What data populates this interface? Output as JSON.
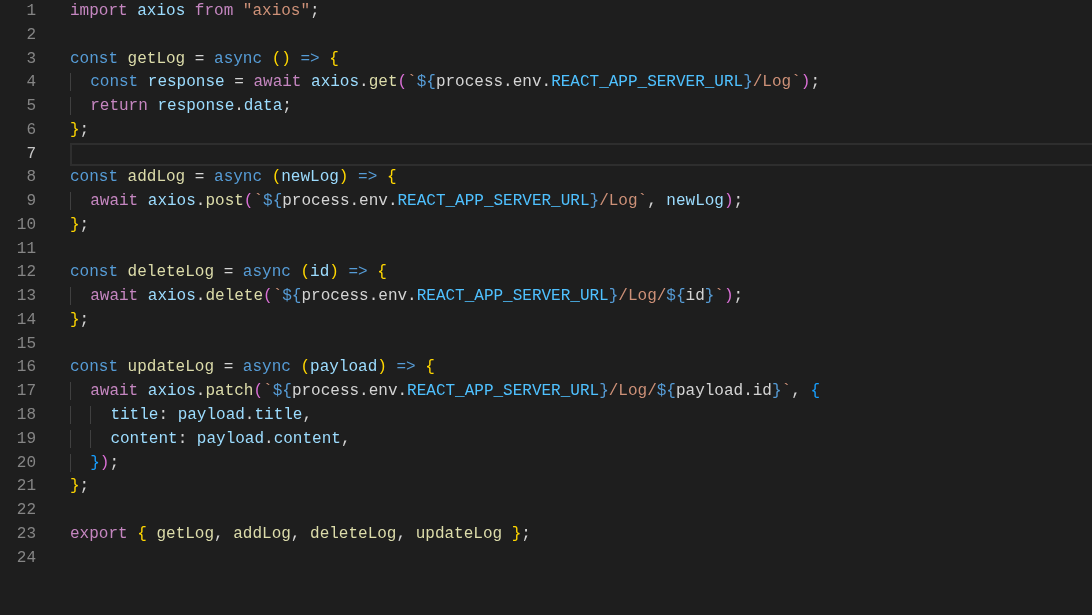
{
  "editor": {
    "lines": [
      {
        "number": "1",
        "current": false,
        "tokens": [
          {
            "text": "import ",
            "kind": "kw"
          },
          {
            "text": "axios ",
            "kind": "var"
          },
          {
            "text": "from ",
            "kind": "kw"
          },
          {
            "text": "\"axios\"",
            "kind": "str"
          },
          {
            "text": ";",
            "kind": "pl"
          }
        ]
      },
      {
        "number": "2",
        "current": false
      },
      {
        "number": "3",
        "current": false,
        "tokens": [
          {
            "text": "const ",
            "kind": "st"
          },
          {
            "text": "getLog",
            "kind": "fn"
          },
          {
            "text": " = ",
            "kind": "pl"
          },
          {
            "text": "async ",
            "kind": "st"
          },
          {
            "text": "() ",
            "kind": "b1"
          },
          {
            "text": "=> ",
            "kind": "st"
          },
          {
            "text": "{",
            "kind": "b1"
          }
        ]
      },
      {
        "number": "4",
        "current": false,
        "tokens": [
          {
            "text": "  const ",
            "kind": "st"
          },
          {
            "text": "response",
            "kind": "var"
          },
          {
            "text": " = ",
            "kind": "pl"
          },
          {
            "text": "await ",
            "kind": "kw"
          },
          {
            "text": "axios",
            "kind": "var"
          },
          {
            "text": ".",
            "kind": "pl"
          },
          {
            "text": "get",
            "kind": "fn"
          },
          {
            "text": "(",
            "kind": "b2"
          },
          {
            "text": "`",
            "kind": "str"
          },
          {
            "text": "${",
            "kind": "tpl"
          },
          {
            "text": "process.env.",
            "kind": "pl"
          },
          {
            "text": "REACT_APP_SERVER_URL",
            "kind": "const"
          },
          {
            "text": "}",
            "kind": "tpl"
          },
          {
            "text": "/Log`",
            "kind": "str"
          },
          {
            "text": ")",
            "kind": "b2"
          },
          {
            "text": ";",
            "kind": "pl"
          }
        ]
      },
      {
        "number": "5",
        "current": false,
        "tokens": [
          {
            "text": "  return ",
            "kind": "kw"
          },
          {
            "text": "response",
            "kind": "var"
          },
          {
            "text": ".",
            "kind": "pl"
          },
          {
            "text": "data",
            "kind": "var"
          },
          {
            "text": ";",
            "kind": "pl"
          }
        ]
      },
      {
        "number": "6",
        "current": false,
        "tokens": [
          {
            "text": "}",
            "kind": "b1"
          },
          {
            "text": ";",
            "kind": "pl"
          }
        ]
      },
      {
        "number": "7",
        "current": true
      },
      {
        "number": "8",
        "current": false,
        "tokens": [
          {
            "text": "const ",
            "kind": "st"
          },
          {
            "text": "addLog",
            "kind": "fn"
          },
          {
            "text": " = ",
            "kind": "pl"
          },
          {
            "text": "async ",
            "kind": "st"
          },
          {
            "text": "(",
            "kind": "b1"
          },
          {
            "text": "newLog",
            "kind": "var"
          },
          {
            "text": ") ",
            "kind": "b1"
          },
          {
            "text": "=> ",
            "kind": "st"
          },
          {
            "text": "{",
            "kind": "b1"
          }
        ]
      },
      {
        "number": "9",
        "current": false,
        "tokens": [
          {
            "text": "  await ",
            "kind": "kw"
          },
          {
            "text": "axios",
            "kind": "var"
          },
          {
            "text": ".",
            "kind": "pl"
          },
          {
            "text": "post",
            "kind": "fn"
          },
          {
            "text": "(",
            "kind": "b2"
          },
          {
            "text": "`",
            "kind": "str"
          },
          {
            "text": "${",
            "kind": "tpl"
          },
          {
            "text": "process.env.",
            "kind": "pl"
          },
          {
            "text": "REACT_APP_SERVER_URL",
            "kind": "const"
          },
          {
            "text": "}",
            "kind": "tpl"
          },
          {
            "text": "/Log`",
            "kind": "str"
          },
          {
            "text": ", ",
            "kind": "pl"
          },
          {
            "text": "newLog",
            "kind": "var"
          },
          {
            "text": ")",
            "kind": "b2"
          },
          {
            "text": ";",
            "kind": "pl"
          }
        ]
      },
      {
        "number": "10",
        "current": false,
        "tokens": [
          {
            "text": "}",
            "kind": "b1"
          },
          {
            "text": ";",
            "kind": "pl"
          }
        ]
      },
      {
        "number": "11",
        "current": false
      },
      {
        "number": "12",
        "current": false,
        "tokens": [
          {
            "text": "const ",
            "kind": "st"
          },
          {
            "text": "deleteLog",
            "kind": "fn"
          },
          {
            "text": " = ",
            "kind": "pl"
          },
          {
            "text": "async ",
            "kind": "st"
          },
          {
            "text": "(",
            "kind": "b1"
          },
          {
            "text": "id",
            "kind": "var"
          },
          {
            "text": ") ",
            "kind": "b1"
          },
          {
            "text": "=> ",
            "kind": "st"
          },
          {
            "text": "{",
            "kind": "b1"
          }
        ]
      },
      {
        "number": "13",
        "current": false,
        "tokens": [
          {
            "text": "  await ",
            "kind": "kw"
          },
          {
            "text": "axios",
            "kind": "var"
          },
          {
            "text": ".",
            "kind": "pl"
          },
          {
            "text": "delete",
            "kind": "fn"
          },
          {
            "text": "(",
            "kind": "b2"
          },
          {
            "text": "`",
            "kind": "str"
          },
          {
            "text": "${",
            "kind": "tpl"
          },
          {
            "text": "process.env.",
            "kind": "pl"
          },
          {
            "text": "REACT_APP_SERVER_URL",
            "kind": "const"
          },
          {
            "text": "}",
            "kind": "tpl"
          },
          {
            "text": "/Log/",
            "kind": "str"
          },
          {
            "text": "${",
            "kind": "tpl"
          },
          {
            "text": "id",
            "kind": "pl"
          },
          {
            "text": "}",
            "kind": "tpl"
          },
          {
            "text": "`",
            "kind": "str"
          },
          {
            "text": ")",
            "kind": "b2"
          },
          {
            "text": ";",
            "kind": "pl"
          }
        ]
      },
      {
        "number": "14",
        "current": false,
        "tokens": [
          {
            "text": "}",
            "kind": "b1"
          },
          {
            "text": ";",
            "kind": "pl"
          }
        ]
      },
      {
        "number": "15",
        "current": false
      },
      {
        "number": "16",
        "current": false,
        "tokens": [
          {
            "text": "const ",
            "kind": "st"
          },
          {
            "text": "updateLog",
            "kind": "fn"
          },
          {
            "text": " = ",
            "kind": "pl"
          },
          {
            "text": "async ",
            "kind": "st"
          },
          {
            "text": "(",
            "kind": "b1"
          },
          {
            "text": "payload",
            "kind": "var"
          },
          {
            "text": ") ",
            "kind": "b1"
          },
          {
            "text": "=> ",
            "kind": "st"
          },
          {
            "text": "{",
            "kind": "b1"
          }
        ]
      },
      {
        "number": "17",
        "current": false,
        "tokens": [
          {
            "text": "  await ",
            "kind": "kw"
          },
          {
            "text": "axios",
            "kind": "var"
          },
          {
            "text": ".",
            "kind": "pl"
          },
          {
            "text": "patch",
            "kind": "fn"
          },
          {
            "text": "(",
            "kind": "b2"
          },
          {
            "text": "`",
            "kind": "str"
          },
          {
            "text": "${",
            "kind": "tpl"
          },
          {
            "text": "process.env.",
            "kind": "pl"
          },
          {
            "text": "REACT_APP_SERVER_URL",
            "kind": "const"
          },
          {
            "text": "}",
            "kind": "tpl"
          },
          {
            "text": "/Log/",
            "kind": "str"
          },
          {
            "text": "${",
            "kind": "tpl"
          },
          {
            "text": "payload.id",
            "kind": "pl"
          },
          {
            "text": "}",
            "kind": "tpl"
          },
          {
            "text": "`",
            "kind": "str"
          },
          {
            "text": ", ",
            "kind": "pl"
          },
          {
            "text": "{",
            "kind": "b3"
          }
        ]
      },
      {
        "number": "18",
        "current": false,
        "tokens": [
          {
            "text": "    title",
            "kind": "var"
          },
          {
            "text": ": ",
            "kind": "pl"
          },
          {
            "text": "payload",
            "kind": "var"
          },
          {
            "text": ".",
            "kind": "pl"
          },
          {
            "text": "title",
            "kind": "var"
          },
          {
            "text": ",",
            "kind": "pl"
          }
        ]
      },
      {
        "number": "19",
        "current": false,
        "tokens": [
          {
            "text": "    content",
            "kind": "var"
          },
          {
            "text": ": ",
            "kind": "pl"
          },
          {
            "text": "payload",
            "kind": "var"
          },
          {
            "text": ".",
            "kind": "pl"
          },
          {
            "text": "content",
            "kind": "var"
          },
          {
            "text": ",",
            "kind": "pl"
          }
        ]
      },
      {
        "number": "20",
        "current": false,
        "tokens": [
          {
            "text": "  }",
            "kind": "b3"
          },
          {
            "text": ")",
            "kind": "b2"
          },
          {
            "text": ";",
            "kind": "pl"
          }
        ]
      },
      {
        "number": "21",
        "current": false,
        "tokens": [
          {
            "text": "}",
            "kind": "b1"
          },
          {
            "text": ";",
            "kind": "pl"
          }
        ]
      },
      {
        "number": "22",
        "current": false
      },
      {
        "number": "23",
        "current": false,
        "tokens": [
          {
            "text": "export ",
            "kind": "kw"
          },
          {
            "text": "{ ",
            "kind": "b1"
          },
          {
            "text": "getLog",
            "kind": "fn"
          },
          {
            "text": ", ",
            "kind": "pl"
          },
          {
            "text": "addLog",
            "kind": "fn"
          },
          {
            "text": ", ",
            "kind": "pl"
          },
          {
            "text": "deleteLog",
            "kind": "fn"
          },
          {
            "text": ", ",
            "kind": "pl"
          },
          {
            "text": "updateLog ",
            "kind": "fn"
          },
          {
            "text": "}",
            "kind": "b1"
          },
          {
            "text": ";",
            "kind": "pl"
          }
        ]
      },
      {
        "number": "24",
        "current": false
      }
    ]
  }
}
